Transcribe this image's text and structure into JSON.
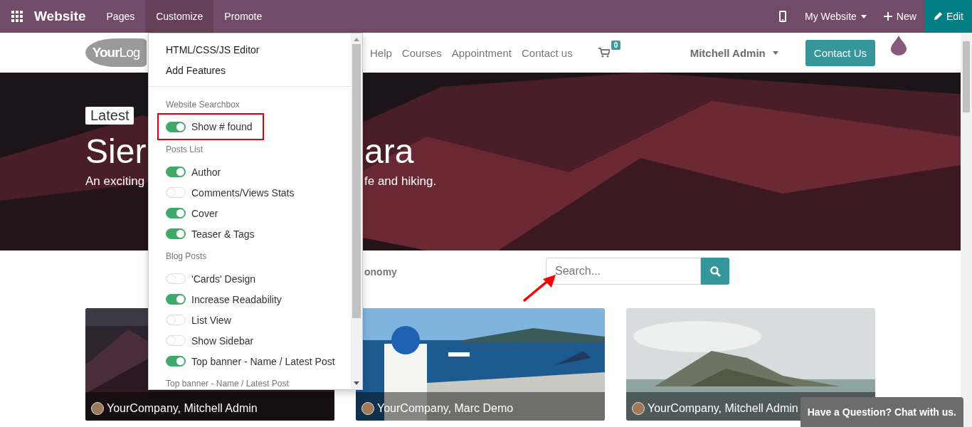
{
  "top_bar": {
    "app_title": "Website",
    "menus": [
      {
        "label": "Pages",
        "selected": false
      },
      {
        "label": "Customize",
        "selected": true
      },
      {
        "label": "Promote",
        "selected": false
      }
    ],
    "website_switcher": "My Website",
    "new_button": "New",
    "edit_button": "Edit"
  },
  "site_header": {
    "logo": "**Your**Log",
    "nav": [
      "Help",
      "Courses",
      "Appointment",
      "Contact us"
    ],
    "cart_count": "0",
    "user": "Mitchell Admin",
    "cta": "Contact Us"
  },
  "hero": {
    "badge": "Latest",
    "title_parts": [
      "Sier",
      "ara"
    ],
    "subtitle_parts": [
      "An exciting",
      "fe and hiking."
    ]
  },
  "blog_bar": {
    "category": "onomy",
    "search": {
      "placeholder": "Search..."
    }
  },
  "posts": [
    {
      "author": "YourCompany, Mitchell Admin"
    },
    {
      "author": "YourCompany, Marc Demo"
    },
    {
      "author": "YourCompany, Mitchell Admin"
    }
  ],
  "customize_menu": {
    "links": [
      "HTML/CSS/JS Editor",
      "Add Features"
    ],
    "sections": [
      {
        "title": "Website Searchbox",
        "options": [
          {
            "label": "Show # found",
            "on": true,
            "highlighted": true
          }
        ]
      },
      {
        "title": "Posts List",
        "options": [
          {
            "label": "Author",
            "on": true,
            "highlighted": false
          },
          {
            "label": "Comments/Views Stats",
            "on": false,
            "highlighted": false
          },
          {
            "label": "Cover",
            "on": true,
            "highlighted": false
          },
          {
            "label": "Teaser & Tags",
            "on": true,
            "highlighted": false
          }
        ]
      },
      {
        "title": "Blog Posts",
        "options": [
          {
            "label": "'Cards' Design",
            "on": false,
            "highlighted": false
          },
          {
            "label": "Increase Readability",
            "on": true,
            "highlighted": false
          },
          {
            "label": "List View",
            "on": false,
            "highlighted": false
          },
          {
            "label": "Show Sidebar",
            "on": false,
            "highlighted": false
          },
          {
            "label": "Top banner - Name / Latest Post",
            "on": true,
            "highlighted": false
          }
        ]
      }
    ],
    "last_header": "Top banner - Name / Latest Post"
  },
  "chat_button": "Have a Question? Chat with us."
}
